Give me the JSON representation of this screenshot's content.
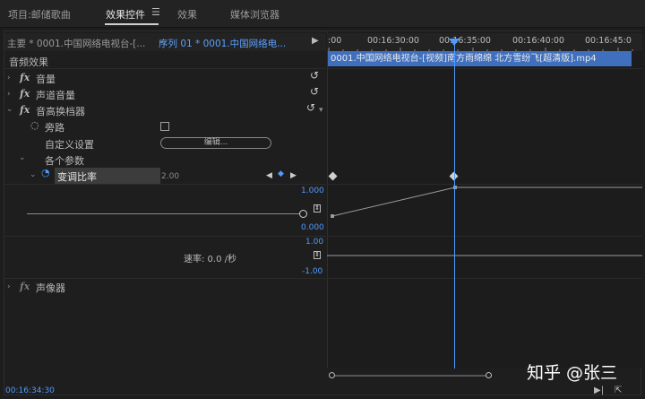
{
  "tabs": [
    {
      "label": "项目:邮储歌曲"
    },
    {
      "label": "效果控件",
      "active": true
    },
    {
      "label": "效果"
    },
    {
      "label": "媒体浏览器"
    }
  ],
  "menu_icon": "hamburger-icon",
  "header": {
    "main_crumb": "主要 * 0001.中国网络电视台-[...",
    "sequence_crumb": "序列 01 * 0001.中国网络电...",
    "play_icon": "play-triangle-icon"
  },
  "effects": {
    "section_title": "音频效果",
    "volume": "音量",
    "channel_volume": "声道音量",
    "pitch_shifter": "音高换档器",
    "bypass_label": "旁路",
    "custom_setup_label": "自定义设置",
    "edit_button": "编辑...",
    "params_label": "各个参数",
    "transpose_ratio_label": "变调比率",
    "transpose_ratio_value": "2.00",
    "graph_max": "1.000",
    "graph_min": "0.000",
    "velocity_max": "1.00",
    "velocity_min": "-1.00",
    "velocity_label": "速率: 0.0 /秒",
    "panner": "声像器"
  },
  "timeline": {
    "tick_labels": [
      ":00",
      "00:16:30:00",
      "00:16:35:00",
      "00:16:40:00",
      "00:16:45:0"
    ],
    "clip_label": "0001.中国网络电视台-[视频]南方雨绵绵 北方雪纷飞[超清版].mp4"
  },
  "status": {
    "timecode": "00:16:34:30"
  },
  "watermark": "知乎 @张三",
  "colors": {
    "accent": "#4f9bff",
    "clip": "#3f6fbd",
    "background": "#1d1d1d"
  }
}
